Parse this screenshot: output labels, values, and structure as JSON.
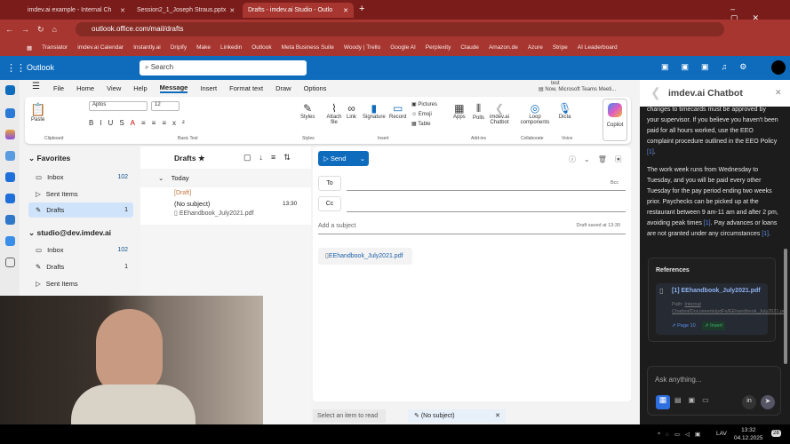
{
  "browser": {
    "tabs": [
      {
        "label": "imdev.ai example - Internal Ch"
      },
      {
        "label": "Session2_1_Joseph Straus.pptx"
      },
      {
        "label": "Drafts - imdev.ai Studio - Outlo"
      }
    ],
    "url": "outlook.office.com/mail/drafts",
    "bookmarks": [
      "Translator",
      "imdev.ai Calendar",
      "Instantly.ai",
      "Dripify",
      "Make",
      "Linkedin",
      "Outlook",
      "Meta Business Suite",
      "Woody | Trello",
      "Google AI",
      "Perplexity",
      "Claude",
      "Amazon.de",
      "Azure",
      "Stripe",
      "AI Leaderboard"
    ]
  },
  "header": {
    "app": "Outlook",
    "search_placeholder": "Search",
    "accent": "#0f6cbd"
  },
  "ribbon": {
    "tabs": [
      "File",
      "Home",
      "View",
      "Help",
      "Message",
      "Insert",
      "Format text",
      "Draw",
      "Options"
    ],
    "active_tab": "Message",
    "notification": {
      "title": "test",
      "subtitle": "Now, Microsoft Teams Meeti..."
    },
    "font": "Aptos",
    "size": "12",
    "paste": "Paste",
    "styles": "Styles",
    "attach": "Attach file",
    "link": "Link",
    "signature": "Signature",
    "record": "Record",
    "pictures": "Pictures",
    "emoji": "Emoji",
    "table": "Table",
    "apps": "Apps",
    "polls": "Polls",
    "chatbot": "imdev.ai Chatbot",
    "loop": "Loop components",
    "dictate": "Dicta",
    "copilot": "Copilot",
    "groups": [
      "Clipboard",
      "Basic Text",
      "Styles",
      "Insert",
      "Add-ins",
      "Collaborate",
      "Voice"
    ]
  },
  "folders": {
    "favorites": "Favorites",
    "fav_items": [
      {
        "label": "Inbox",
        "count": "102"
      },
      {
        "label": "Sent Items",
        "count": ""
      },
      {
        "label": "Drafts",
        "count": "1"
      }
    ],
    "account": "studio@dev.imdev.ai",
    "acct_items": [
      {
        "label": "Inbox",
        "count": "102"
      },
      {
        "label": "Drafts",
        "count": "1"
      },
      {
        "label": "Sent Items",
        "count": ""
      }
    ]
  },
  "list": {
    "title": "Drafts",
    "group": "Today",
    "item": {
      "tag": "[Draft]",
      "subject": "(No subject)",
      "time": "13:30",
      "attachment": "EEhandbook_July2021.pdf"
    }
  },
  "compose": {
    "send": "Send",
    "to": "To",
    "cc": "Cc",
    "bcc": "Bcc",
    "subject_placeholder": "Add a subject",
    "saved": "Draft saved at 13:30",
    "attachment": "EEhandbook_July2021.pdf"
  },
  "bottom": {
    "read": "Select an item to read",
    "draft_tab": "(No subject)"
  },
  "chatbot": {
    "title": "imdev.ai Chatbot",
    "p1": "changes to timecards must be approved by your supervisor. If you believe you haven't been paid for all hours worked, use the EEO complaint procedure outlined in the EEO Policy",
    "p2a": "The work week runs from Wednesday to Tuesday, and you will be paid every other Tuesday for the pay period ending two weeks prior. Paychecks can be picked up at the restaurant between 9 am-11 am and after 2 pm, avoiding peak times",
    "p2b": ". Pay advances or loans are not granted under any circumstances",
    "cite": "[1]",
    "refs_title": "References",
    "ref_name": "[1] EEhandbook_July2021.pdf",
    "ref_path_label": "Path:",
    "ref_path": "Internal Chatbot/Documents/pdFs/EEhandbook_July2021.pdf",
    "page_btn": "Page 10",
    "insert_btn": "Insert",
    "input_placeholder": "Ask anything..."
  },
  "taskbar": {
    "lang": "LAV",
    "time": "13:32",
    "date": "04.12.2025",
    "badge": "28"
  }
}
